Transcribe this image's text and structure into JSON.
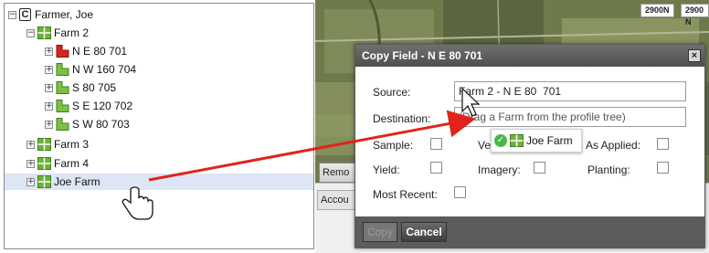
{
  "tree": {
    "client": {
      "label": "Farmer, Joe",
      "letter": "C"
    },
    "farm2": {
      "label": "Farm 2"
    },
    "fields": [
      {
        "label": "N E 80 701",
        "color": "#d9231f"
      },
      {
        "label": "N W 160 704",
        "color": "#7cc143"
      },
      {
        "label": "S 80 705",
        "color": "#7cc143"
      },
      {
        "label": "S E 120 702",
        "color": "#7cc143"
      },
      {
        "label": "S W 80 703",
        "color": "#7cc143"
      }
    ],
    "farm3": {
      "label": "Farm 3"
    },
    "farm4": {
      "label": "Farm 4"
    },
    "joe_farm": {
      "label": "Joe Farm"
    },
    "expanded_glyph": "−",
    "collapsed_glyph": "+"
  },
  "map": {
    "tags": [
      "2900N",
      "2900 N"
    ],
    "remove_button": "Remo",
    "account_tab": "Accou"
  },
  "dialog": {
    "title": "Copy Field - N E 80 701",
    "close_glyph": "×",
    "source_label": "Source:",
    "source_value": "Farm 2 - N E 80  701",
    "destination_label": "Destination:",
    "destination_placeholder": "(Drag a Farm from the profile tree)",
    "sample_label": "Sample:",
    "ve_label": "Ve",
    "as_applied_label": "As Applied:",
    "yield_label": "Yield:",
    "imagery_label": "Imagery:",
    "planting_label": "Planting:",
    "most_recent_label": "Most Recent:",
    "copy_button": "Copy",
    "cancel_button": "Cancel"
  },
  "drag_proxy": {
    "label": "Joe Farm",
    "ok_glyph": "✓"
  },
  "colors": {
    "farm_icon": "#6bb536",
    "field_green": "#7cc143",
    "field_red": "#d9231f",
    "arrow": "#e0241b",
    "selection": "#dce6f4"
  }
}
